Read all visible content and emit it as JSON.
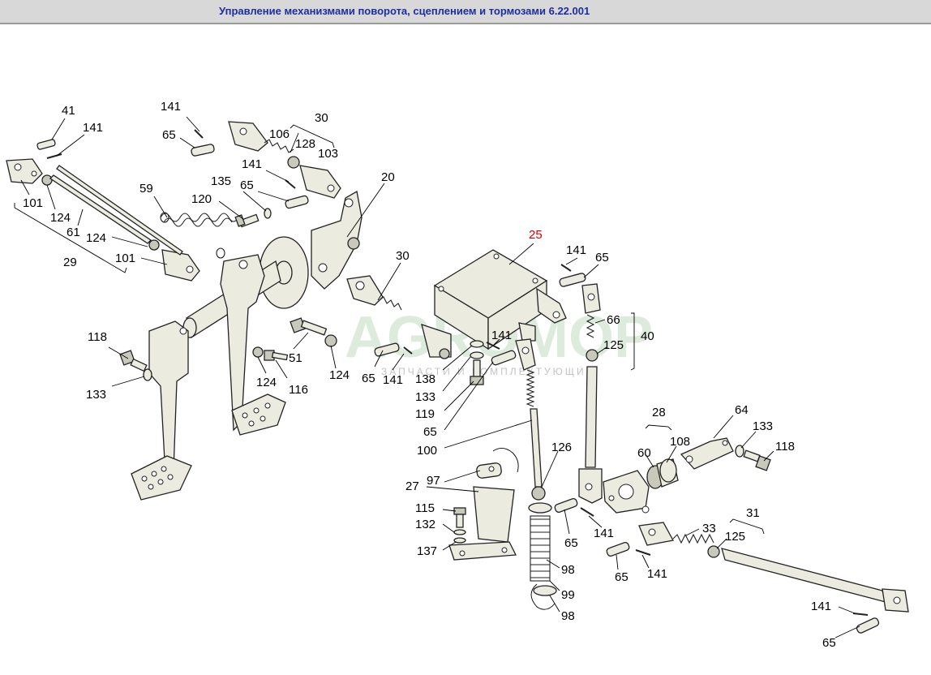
{
  "window": {
    "title": "Управление механизмами поворота, сцеплением и тормозами 6.22.001"
  },
  "watermark": {
    "brand": "AGROMOP",
    "tagline": "ЗАПЧАСТИ И КОМПЛЕКТУЮЩИЕ"
  },
  "colors": {
    "title_text": "#1d2ea0",
    "highlight_label": "#d40000",
    "part_fill": "#ebebe0"
  },
  "callouts": [
    {
      "id": "c41",
      "text": "41"
    },
    {
      "id": "c141a",
      "text": "141"
    },
    {
      "id": "c101a",
      "text": "101"
    },
    {
      "id": "c124a",
      "text": "124"
    },
    {
      "id": "c61",
      "text": "61"
    },
    {
      "id": "c124b",
      "text": "124"
    },
    {
      "id": "c29",
      "text": "29"
    },
    {
      "id": "c101b",
      "text": "101"
    },
    {
      "id": "c59",
      "text": "59"
    },
    {
      "id": "c141b",
      "text": "141"
    },
    {
      "id": "c65a",
      "text": "65"
    },
    {
      "id": "c135",
      "text": "135"
    },
    {
      "id": "c65b",
      "text": "65"
    },
    {
      "id": "c120",
      "text": "120"
    },
    {
      "id": "c30a",
      "text": "30"
    },
    {
      "id": "c106",
      "text": "106"
    },
    {
      "id": "c128",
      "text": "128"
    },
    {
      "id": "c103",
      "text": "103"
    },
    {
      "id": "c141c",
      "text": "141"
    },
    {
      "id": "c20",
      "text": "20"
    },
    {
      "id": "c118a",
      "text": "118"
    },
    {
      "id": "c133a",
      "text": "133"
    },
    {
      "id": "c51",
      "text": "51"
    },
    {
      "id": "c124c",
      "text": "124"
    },
    {
      "id": "c116",
      "text": "116"
    },
    {
      "id": "c124d",
      "text": "124"
    },
    {
      "id": "c65c",
      "text": "65"
    },
    {
      "id": "c141d",
      "text": "141"
    },
    {
      "id": "c30b",
      "text": "30"
    },
    {
      "id": "c25",
      "text": "25"
    },
    {
      "id": "c141e",
      "text": "141"
    },
    {
      "id": "c65d",
      "text": "65"
    },
    {
      "id": "c66",
      "text": "66"
    },
    {
      "id": "c125a",
      "text": "125"
    },
    {
      "id": "c40",
      "text": "40"
    },
    {
      "id": "c141f",
      "text": "141"
    },
    {
      "id": "c138",
      "text": "138"
    },
    {
      "id": "c133b",
      "text": "133"
    },
    {
      "id": "c119",
      "text": "119"
    },
    {
      "id": "c65e",
      "text": "65"
    },
    {
      "id": "c100",
      "text": "100"
    },
    {
      "id": "c28",
      "text": "28"
    },
    {
      "id": "c64",
      "text": "64"
    },
    {
      "id": "c133c",
      "text": "133"
    },
    {
      "id": "c118b",
      "text": "118"
    },
    {
      "id": "c108",
      "text": "108"
    },
    {
      "id": "c60",
      "text": "60"
    },
    {
      "id": "c126",
      "text": "126"
    },
    {
      "id": "c97",
      "text": "97"
    },
    {
      "id": "c27",
      "text": "27"
    },
    {
      "id": "c115",
      "text": "115"
    },
    {
      "id": "c132",
      "text": "132"
    },
    {
      "id": "c137",
      "text": "137"
    },
    {
      "id": "c65f",
      "text": "65"
    },
    {
      "id": "c141g",
      "text": "141"
    },
    {
      "id": "c31",
      "text": "31"
    },
    {
      "id": "c33",
      "text": "33"
    },
    {
      "id": "c125b",
      "text": "125"
    },
    {
      "id": "c98a",
      "text": "98"
    },
    {
      "id": "c99",
      "text": "99"
    },
    {
      "id": "c98b",
      "text": "98"
    },
    {
      "id": "c65g",
      "text": "65"
    },
    {
      "id": "c141h",
      "text": "141"
    },
    {
      "id": "c141i",
      "text": "141"
    },
    {
      "id": "c65h",
      "text": "65"
    }
  ]
}
